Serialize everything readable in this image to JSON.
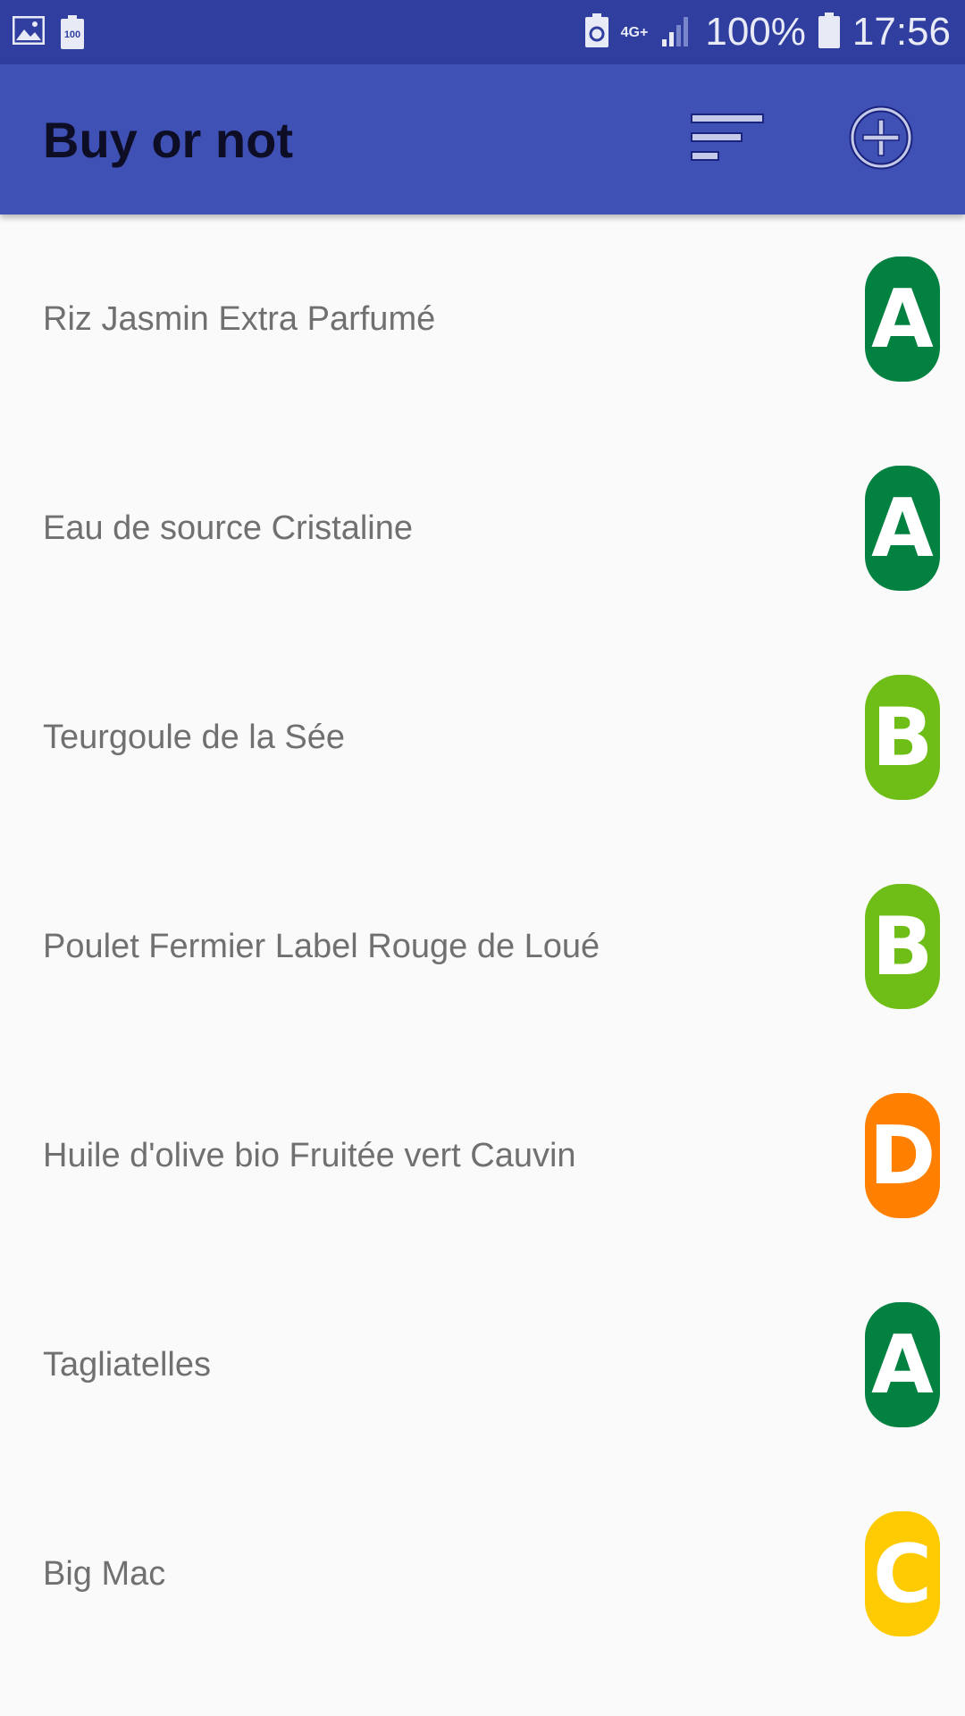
{
  "status_bar": {
    "battery_percent": "100%",
    "time": "17:56",
    "network": "4G+",
    "notification_battery_label": "100"
  },
  "app_bar": {
    "title": "Buy or not",
    "sort_icon": "sort-icon",
    "add_icon": "add-circle-icon"
  },
  "colors": {
    "status_bar": "#303f9f",
    "app_bar": "#3f51b5",
    "grade_A": "#038141",
    "grade_B": "#6fbe18",
    "grade_C": "#fecb02",
    "grade_D": "#ff7f00"
  },
  "products": [
    {
      "name": "Riz Jasmin Extra Parfumé",
      "grade": "A",
      "color": "#038141"
    },
    {
      "name": "Eau de source Cristaline",
      "grade": "A",
      "color": "#038141"
    },
    {
      "name": "Teurgoule de la Sée",
      "grade": "B",
      "color": "#6fbe18"
    },
    {
      "name": "Poulet Fermier Label Rouge de Loué",
      "grade": "B",
      "color": "#6fbe18"
    },
    {
      "name": "Huile d'olive bio Fruitée vert Cauvin",
      "grade": "D",
      "color": "#ff7f00"
    },
    {
      "name": "Tagliatelles",
      "grade": "A",
      "color": "#038141"
    },
    {
      "name": "Big Mac",
      "grade": "C",
      "color": "#fecb02"
    }
  ]
}
